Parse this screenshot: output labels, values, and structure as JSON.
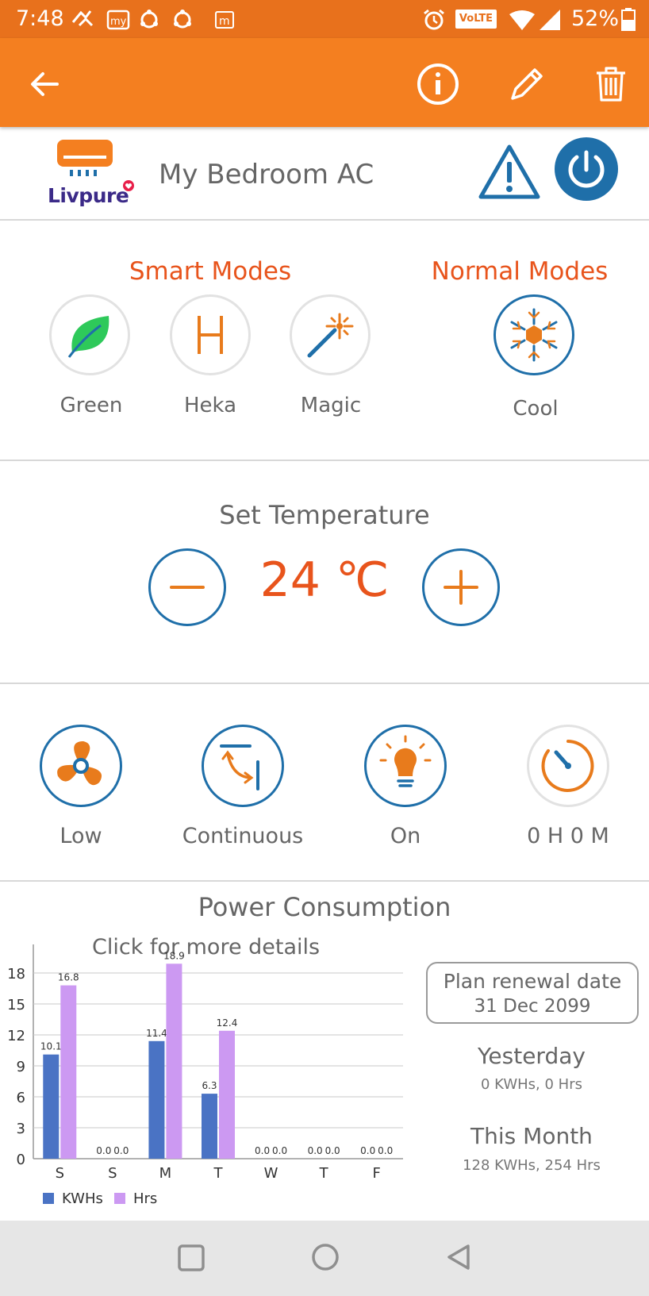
{
  "status_bar": {
    "time": "7:48",
    "network": "VoLTE",
    "battery": "52%"
  },
  "device": {
    "name": "My Bedroom AC",
    "brand": "Livpure"
  },
  "modes": {
    "smart_title": "Smart Modes",
    "normal_title": "Normal Modes",
    "smart": [
      {
        "label": "Green",
        "icon": "leaf-icon"
      },
      {
        "label": "Heka",
        "icon": "heka-icon"
      },
      {
        "label": "Magic",
        "icon": "magic-wand-icon"
      }
    ],
    "normal": [
      {
        "label": "Cool",
        "icon": "snowflake-icon",
        "selected": true
      }
    ]
  },
  "temperature": {
    "title": "Set Temperature",
    "value": "24 ℃"
  },
  "controls": [
    {
      "label": "Low",
      "icon": "fan-icon"
    },
    {
      "label": "Continuous",
      "icon": "swing-icon"
    },
    {
      "label": "On",
      "icon": "light-bulb-icon"
    },
    {
      "label": "0 H 0 M",
      "icon": "timer-icon"
    }
  ],
  "power": {
    "title": "Power Consumption",
    "click_more": "Click for more details",
    "plan_label": "Plan renewal date",
    "plan_date": "31 Dec 2099",
    "yesterday_title": "Yesterday",
    "yesterday_value": "0 KWHs, 0 Hrs",
    "month_title": "This Month",
    "month_value": "128 KWHs, 254 Hrs"
  },
  "chart_data": {
    "type": "bar",
    "categories": [
      "S",
      "S",
      "M",
      "T",
      "W",
      "T",
      "F"
    ],
    "series": [
      {
        "name": "KWHs",
        "values": [
          10.1,
          0.0,
          11.4,
          6.3,
          0.0,
          0.0,
          0.0
        ]
      },
      {
        "name": "Hrs",
        "values": [
          16.8,
          0.0,
          18.9,
          12.4,
          0.0,
          0.0,
          0.0
        ]
      }
    ],
    "ylim": [
      0,
      20
    ],
    "yticks": [
      0,
      3,
      6,
      9,
      12,
      15,
      18
    ],
    "grid": true,
    "legend": "bottom-left",
    "colors": {
      "KWHs": "#4a73c4",
      "Hrs": "#cc99f2"
    }
  },
  "colors": {
    "orange": "#f47f20",
    "blue": "#1f6fa9",
    "accent_text": "#e8541c"
  }
}
